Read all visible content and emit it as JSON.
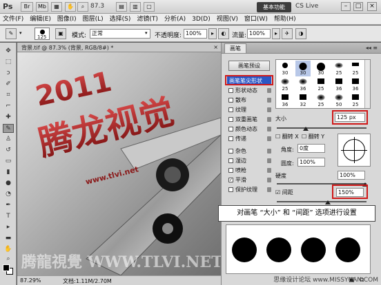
{
  "titlebar": {
    "app_logo": "Ps",
    "br_label": "Br",
    "mb_label": "Mb",
    "zoom": "87.3",
    "workspace": "基本功能",
    "cslive": "CS Live"
  },
  "menu": [
    "文件(F)",
    "编辑(E)",
    "图像(I)",
    "图层(L)",
    "选择(S)",
    "滤镜(T)",
    "分析(A)",
    "3D(D)",
    "视图(V)",
    "窗口(W)",
    "帮助(H)"
  ],
  "options": {
    "brush_size": "125",
    "mode_label": "模式:",
    "mode_value": "正常",
    "opacity_label": "不透明度:",
    "opacity_value": "100%",
    "flow_label": "流量:",
    "flow_value": "100%"
  },
  "document": {
    "tab_title": "背景.tif @ 87.3% (背景, RGB/8#) *",
    "close": "×",
    "zoom_status": "87.29%",
    "doc_size": "文档:1.11M/2.70M",
    "canvas_title_line1": "2011",
    "canvas_title_line2": "腾龙视觉",
    "canvas_url": "www.tlvi.net",
    "canvas_watermark": "腾龍視覺 WWW.TLVI.NET"
  },
  "brush_panel": {
    "tab": "画笔",
    "preset_button": "画笔预设",
    "options": [
      {
        "label": "画笔笔尖形状",
        "checked": false
      },
      {
        "label": "形状动态",
        "checked": false
      },
      {
        "label": "散布",
        "checked": false
      },
      {
        "label": "纹理",
        "checked": false
      },
      {
        "label": "双重画笔",
        "checked": false
      },
      {
        "label": "颜色动态",
        "checked": false
      },
      {
        "label": "传递",
        "checked": false
      },
      {
        "label": "杂色",
        "checked": false
      },
      {
        "label": "湿边",
        "checked": false
      },
      {
        "label": "喷枪",
        "checked": false
      },
      {
        "label": "平滑",
        "checked": true
      },
      {
        "label": "保护纹理",
        "checked": false
      }
    ],
    "tips_row1": [
      "30",
      "30",
      "30",
      "25",
      "25"
    ],
    "tips_row2": [
      "25",
      "36",
      "25",
      "36",
      "36"
    ],
    "tips_row3": [
      "36",
      "32",
      "25",
      "50",
      "25"
    ],
    "size_label": "大小",
    "size_value": "125 px",
    "flip_x": "翻转 X",
    "flip_y": "翻转 Y",
    "angle_label": "角度:",
    "angle_value": "0度",
    "roundness_label": "圆度:",
    "roundness_value": "100%",
    "hardness_label": "硬度",
    "hardness_value": "100%",
    "spacing_label": "间距",
    "spacing_value": "150%"
  },
  "caption": "对画笔 “大小” 和 “间距” 选项进行设置",
  "footer_watermark": "思缘设计论坛 www.MISSYUAN.COM"
}
